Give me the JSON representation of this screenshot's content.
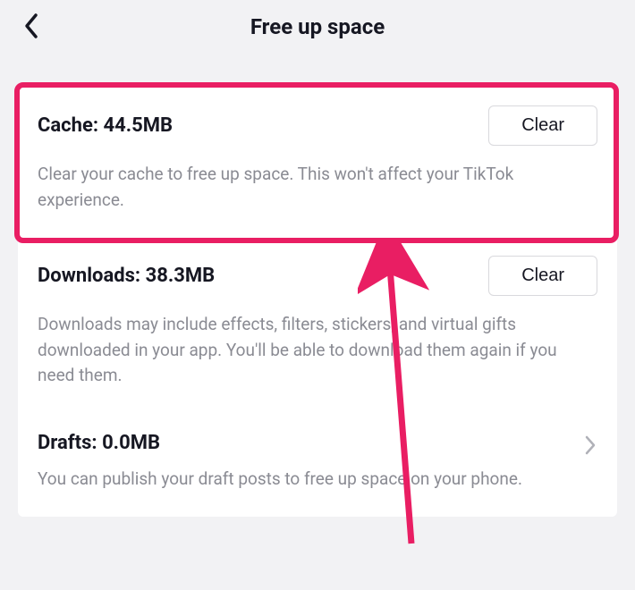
{
  "header": {
    "title": "Free up space"
  },
  "rows": {
    "cache": {
      "label": "Cache: ",
      "value": "44.5MB",
      "button": "Clear",
      "desc": "Clear your cache to free up space. This won't affect your TikTok experience."
    },
    "downloads": {
      "label": "Downloads: ",
      "value": "38.3MB",
      "button": "Clear",
      "desc": "Downloads may include effects, filters, stickers, and virtual gifts downloaded in your app. You'll be able to download them again if you need them."
    },
    "drafts": {
      "label": "Drafts: ",
      "value": "0.0MB",
      "desc": "You can publish your draft posts to free up space on your phone."
    }
  },
  "annotation": {
    "highlight_color": "#e91e63",
    "arrow_color": "#e91e63"
  }
}
